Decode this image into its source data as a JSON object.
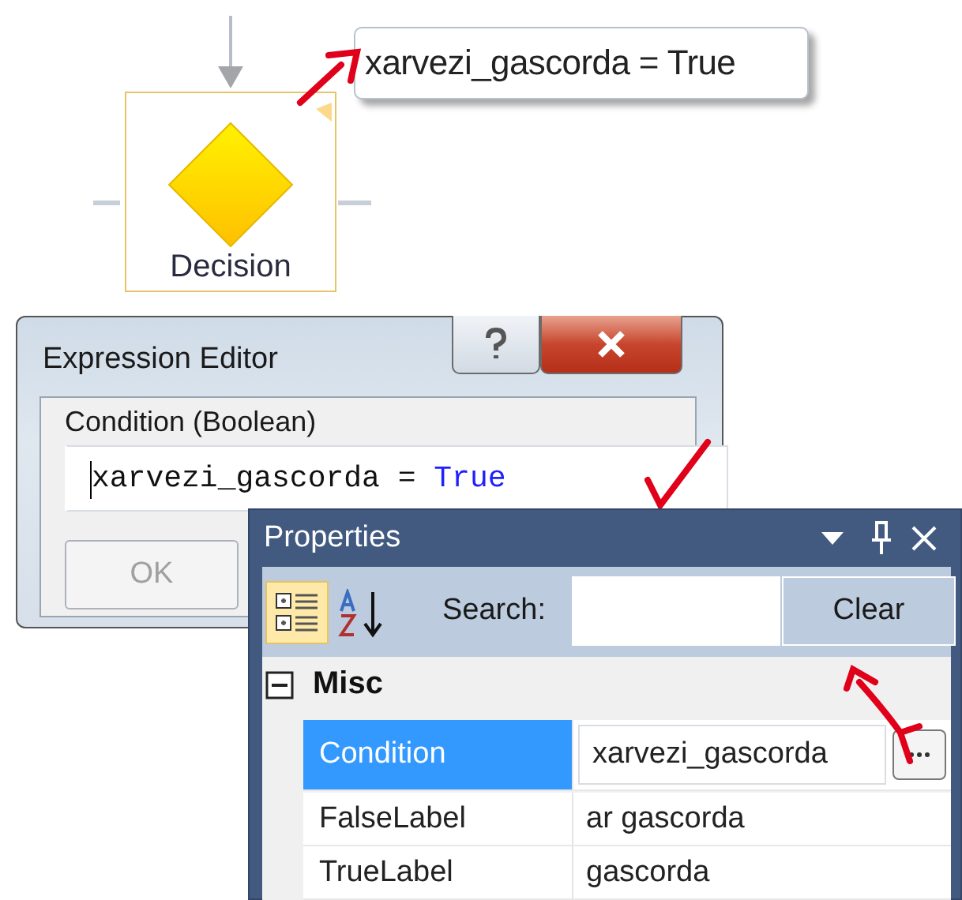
{
  "diagram": {
    "node_label": "Decision",
    "tooltip": "xarvezi_gascorda = True"
  },
  "expression_editor": {
    "title": "Expression Editor",
    "field_label": "Condition (Boolean)",
    "expression": [
      {
        "text": "xarvezi_gascorda = ",
        "kind": "plain"
      },
      {
        "text": "True",
        "kind": "keyword"
      }
    ],
    "ok_button": {
      "label": "OK",
      "disabled": true
    }
  },
  "properties": {
    "title": "Properties",
    "categorized_selected": true,
    "search_label": "Search:",
    "clear_button": "Clear",
    "category": {
      "label": "Misc",
      "expanded": true
    },
    "rows": [
      {
        "name": "Condition",
        "value": "xarvezi_gascorda",
        "selected": true,
        "kind": "editor"
      },
      {
        "name": "FalseLabel",
        "value": "ar gascorda",
        "selected": false,
        "kind": "text"
      },
      {
        "name": "TrueLabel",
        "value": "gascorda",
        "selected": false,
        "kind": "text"
      }
    ]
  }
}
